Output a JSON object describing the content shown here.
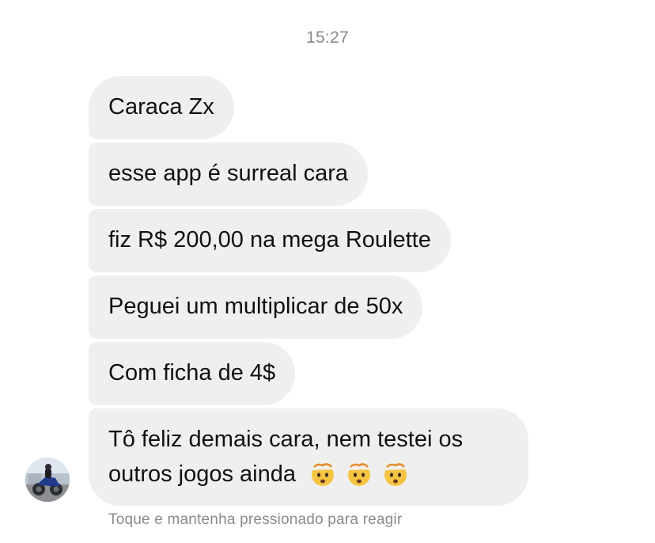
{
  "conversation": {
    "timestamp": "15:27",
    "messages": [
      {
        "text": "Caraca Zx"
      },
      {
        "text": "esse app é surreal cara"
      },
      {
        "text": "fiz R$ 200,00 na mega Roulette"
      },
      {
        "text": "Peguei um multiplicar de 50x"
      },
      {
        "text": "Com ficha de 4$"
      },
      {
        "text": "Tô feliz demais cara, nem testei os outros jogos ainda",
        "emojis": [
          "exploding-head-icon",
          "exploding-head-icon",
          "exploding-head-icon"
        ]
      }
    ],
    "reaction_hint": "Toque e mantenha pressionado para reagir"
  },
  "sender": {
    "avatar_icon": "avatar"
  },
  "colors": {
    "bubble_bg": "#efefef",
    "text": "#111111",
    "secondary_text": "#8a8a8e",
    "background": "#ffffff"
  }
}
